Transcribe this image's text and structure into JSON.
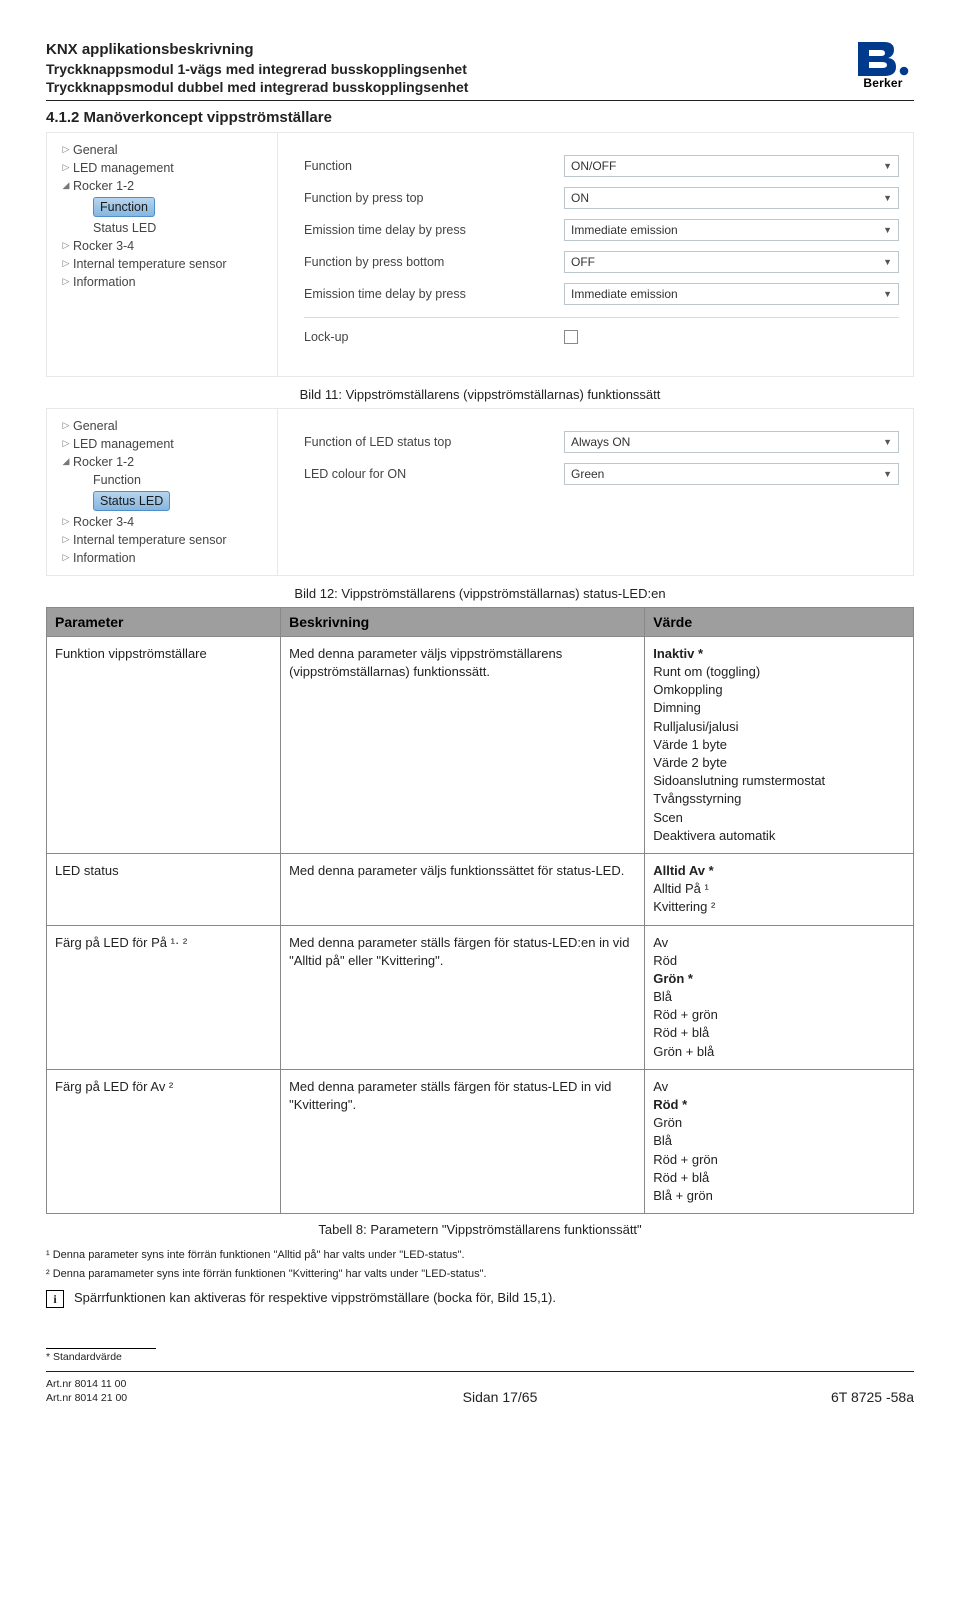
{
  "header": {
    "line1": "KNX applikationsbeskrivning",
    "line2": "Tryckknappsmodul 1-vägs med integrerad busskopplingsenhet",
    "line3": "Tryckknappsmodul dubbel med integrerad busskopplingsenhet",
    "brand": "Berker"
  },
  "section_title": "4.1.2  Manöverkoncept vippströmställare",
  "caption1": "Bild 11:  Vippströmställarens (vippströmställarnas) funktionssätt",
  "caption2": "Bild 12:  Vippströmställarens (vippströmställarnas) status-LED:en",
  "shot1": {
    "tree": [
      "General",
      "LED management",
      "Rocker 1-2",
      "Function",
      "Status LED",
      "Rocker 3-4",
      "Internal temperature sensor",
      "Information"
    ],
    "rows": [
      {
        "label": "Function",
        "value": "ON/OFF"
      },
      {
        "label": "Function by press top",
        "value": "ON"
      },
      {
        "label": "Emission time delay by press",
        "value": "Immediate emission"
      },
      {
        "label": "Function by press bottom",
        "value": "OFF"
      },
      {
        "label": "Emission time delay by press",
        "value": "Immediate emission"
      }
    ],
    "lockup": "Lock-up"
  },
  "shot2": {
    "tree": [
      "General",
      "LED management",
      "Rocker 1-2",
      "Function",
      "Status LED",
      "Rocker 3-4",
      "Internal temperature sensor",
      "Information"
    ],
    "rows": [
      {
        "label": "Function of LED status top",
        "value": "Always ON"
      },
      {
        "label": "LED colour for ON",
        "value": "Green"
      }
    ]
  },
  "table": {
    "head": {
      "c1": "Parameter",
      "c2": "Beskrivning",
      "c3": "Värde"
    },
    "rows": [
      {
        "param": "Funktion vippströmställare",
        "desc": "Med denna parameter väljs vippströmställarens (vippströmställarnas) funktionssätt.",
        "vals": [
          "Inaktiv *",
          "Runt om (toggling)",
          "Omkoppling",
          "Dimning",
          "Rulljalusi/jalusi",
          "Värde 1 byte",
          "Värde 2 byte",
          "Sidoanslutning rumstermostat",
          "Tvångsstyrning",
          "Scen",
          "Deaktivera automatik"
        ]
      },
      {
        "param": "LED status",
        "desc": "Med denna parameter väljs funktionssättet för status-LED.",
        "vals": [
          "Alltid Av *",
          "Alltid På ¹",
          "Kvittering ²"
        ]
      },
      {
        "param": "Färg på LED för På ¹· ²",
        "desc": "Med denna parameter ställs färgen för status-LED:en in vid \"Alltid på\" eller \"Kvittering\".",
        "vals": [
          "Av",
          "Röd",
          "Grön *",
          "Blå",
          "Röd + grön",
          "Röd + blå",
          "Grön + blå"
        ]
      },
      {
        "param": "Färg på LED för Av ²",
        "desc": "Med denna parameter ställs färgen för status-LED in vid \"Kvittering\".",
        "vals": [
          "Av",
          "Röd *",
          "Grön",
          "Blå",
          "Röd + grön",
          "Röd + blå",
          "Blå + grön"
        ]
      }
    ]
  },
  "table_caption": "Tabell 8:  Parametern \"Vippströmställarens funktionssätt\"",
  "footnotes": {
    "fn1": "¹ Denna parameter syns inte förrän funktionen \"Alltid på\" har valts under \"LED-status\".",
    "fn2": "² Denna paramameter syns inte förrän funktionen \"Kvittering\" har valts under \"LED-status\"."
  },
  "info_text": "Spärrfunktionen kan aktiveras för respektive vippströmställare (bocka för, Bild 15,1).",
  "asterisk_legend": "*   Standardvärde",
  "footer": {
    "art1": "Art.nr 8014 11 00",
    "art2": "Art.nr 8014 21 00",
    "mid": "Sidan 17/65",
    "right": "6T 8725 -58a"
  }
}
